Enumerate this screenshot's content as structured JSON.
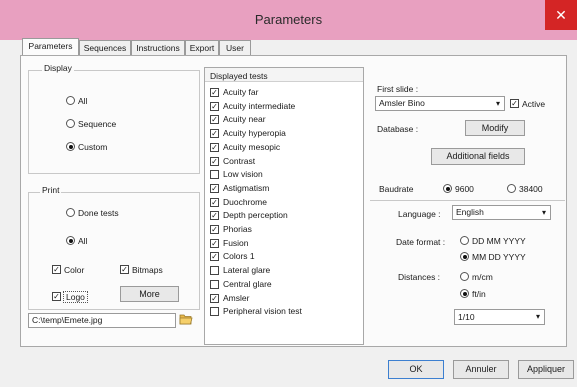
{
  "window": {
    "title": "Parameters",
    "close_symbol": "✕"
  },
  "tabs": [
    {
      "label": "Parameters",
      "active": true
    },
    {
      "label": "Sequences",
      "active": false
    },
    {
      "label": "Instructions",
      "active": false
    },
    {
      "label": "Export",
      "active": false
    },
    {
      "label": "User",
      "active": false
    }
  ],
  "display": {
    "title": "Display",
    "options": [
      {
        "label": "All",
        "selected": false
      },
      {
        "label": "Sequence",
        "selected": false
      },
      {
        "label": "Custom",
        "selected": true
      }
    ]
  },
  "print": {
    "title": "Print",
    "options": [
      {
        "label": "Done tests",
        "selected": false
      },
      {
        "label": "All",
        "selected": true
      }
    ],
    "color_label": "Color",
    "bitmaps_label": "Bitmaps",
    "logo_label": "Logo",
    "more_label": "More",
    "path_value": "C:\\temp\\Emete.jpg"
  },
  "displayed_tests": {
    "header": "Displayed tests",
    "items": [
      {
        "label": "Acuity far",
        "checked": true
      },
      {
        "label": "Acuity intermediate",
        "checked": true
      },
      {
        "label": "Acuity near",
        "checked": true
      },
      {
        "label": "Acuity hyperopia",
        "checked": true
      },
      {
        "label": "Acuity mesopic",
        "checked": true
      },
      {
        "label": "Contrast",
        "checked": true
      },
      {
        "label": "Low vision",
        "checked": false
      },
      {
        "label": "Astigmatism",
        "checked": true
      },
      {
        "label": "Duochrome",
        "checked": true
      },
      {
        "label": "Depth perception",
        "checked": true
      },
      {
        "label": "Phorias",
        "checked": true
      },
      {
        "label": "Fusion",
        "checked": true
      },
      {
        "label": "Colors 1",
        "checked": true
      },
      {
        "label": "Lateral glare",
        "checked": false
      },
      {
        "label": "Central glare",
        "checked": false
      },
      {
        "label": "Amsler",
        "checked": true
      },
      {
        "label": "Peripheral vision test",
        "checked": false
      }
    ]
  },
  "right": {
    "first_slide_label": "First slide :",
    "first_slide_value": "Amsler Bino",
    "active_label": "Active",
    "database_label": "Database :",
    "modify_label": "Modify",
    "additional_fields_label": "Additional fields",
    "baudrate_label": "Baudrate",
    "baud_options": [
      {
        "label": "9600",
        "selected": true
      },
      {
        "label": "38400",
        "selected": false
      }
    ],
    "language_label": "Language :",
    "language_value": "English",
    "date_format_label": "Date format :",
    "date_options": [
      {
        "label": "DD MM YYYY",
        "selected": false
      },
      {
        "label": "MM DD YYYY",
        "selected": true
      }
    ],
    "distances_label": "Distances :",
    "distance_options": [
      {
        "label": "m/cm",
        "selected": false
      },
      {
        "label": "ft/in",
        "selected": true
      }
    ],
    "acuity_value": "1/10"
  },
  "footer": {
    "ok_label": "OK",
    "cancel_label": "Annuler",
    "apply_label": "Appliquer"
  },
  "colors": {
    "titlebar": "#e8a0c0",
    "close": "#d42525"
  }
}
